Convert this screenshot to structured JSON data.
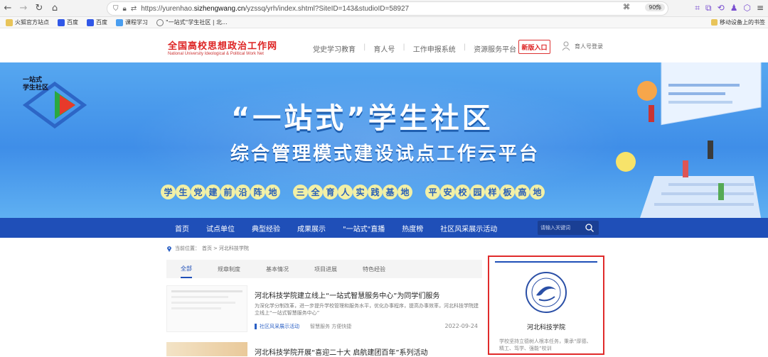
{
  "browser": {
    "url_prefix": "https://yurenhao.",
    "url_domain": "sizhengwang.cn",
    "url_rest": "/yzssq/yrh/index.shtml?SiteID=143&studioID=58927",
    "zoom": "90%"
  },
  "bookmarks": {
    "items": [
      "火狐官方站点",
      "百度",
      "百度",
      "课程学习",
      "\"一站式\"学生社区 | 北..."
    ],
    "right": "移动设备上的书签"
  },
  "header": {
    "logo_cn": "全国高校思想政治工作网",
    "logo_en": "National University Ideological & Political Work Net",
    "nav": [
      "党史学习教育",
      "育人号",
      "工作申报系统",
      "资源服务平台"
    ],
    "new_btn": "新版入口",
    "login": "育人号登录"
  },
  "banner": {
    "logo_text_1": "一站式",
    "logo_text_2": "学生社区",
    "title": "“一站式”学生社区",
    "subtitle": "综合管理模式建设试点工作云平台",
    "pill_1": [
      "学",
      "生",
      "党",
      "建",
      "前",
      "沿",
      "阵",
      "地"
    ],
    "pill_2": [
      "三",
      "全",
      "育",
      "人",
      "实",
      "践",
      "基",
      "地"
    ],
    "pill_3": [
      "平",
      "安",
      "校",
      "园",
      "样",
      "板",
      "高",
      "地"
    ]
  },
  "main_nav": {
    "items": [
      "首页",
      "试点单位",
      "典型经验",
      "成果展示",
      "\"一站式\"直播",
      "热度榜",
      "社区风采展示活动"
    ],
    "search_placeholder": "请输入关键词"
  },
  "breadcrumb": {
    "label": "当前位置：",
    "home": "首页",
    "sep": ">",
    "current": "河北科技学院"
  },
  "tabs": [
    "全部",
    "规章制度",
    "基本情况",
    "项目进展",
    "特色经验"
  ],
  "articles": [
    {
      "title": "河北科技学院建立线上“一站式智慧服务中心”为同学们服务",
      "desc": "为深化学分制改革，进一步提升学校管理和服务水平，优化办事程序，提高办事效率，河北科技学院建立线上“一站式智慧服务中心”",
      "tag": "社区风采展示活动",
      "tag2": "智慧服务 方便快捷",
      "date": "2022-09-24"
    },
    {
      "title": "河北科技学院开展“喜迎二十大 启航建团百年”系列活动"
    }
  ],
  "side_card": {
    "name": "河北科技学院",
    "desc": "学校坚持立德树人根本任务，秉承“厚德、精工、笃学、强能”校训"
  }
}
